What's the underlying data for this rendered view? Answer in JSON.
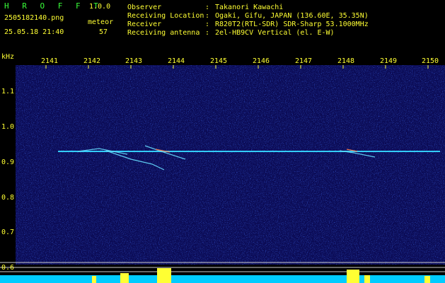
{
  "app": {
    "name": "H R O F F T",
    "version": "1.0.0",
    "filename": "2505182140.png",
    "datetime": "25.05.18 21:40",
    "mode_label": "meteor",
    "count": "57"
  },
  "info": {
    "rows": [
      {
        "label": "Observer",
        "sep": ":",
        "value": "Takanori Kawachi"
      },
      {
        "label": "Receiving Location",
        "sep": ":",
        "value": "Ogaki, Gifu, JAPAN (136.60E, 35.35N)"
      },
      {
        "label": "Receiver",
        "sep": ":",
        "value": "R820T2(RTL-SDR) SDR-Sharp 53.1000MHz"
      },
      {
        "label": "Receiving antenna",
        "sep": ":",
        "value": "2el-HB9CV Vertical (el. E-W)"
      }
    ]
  },
  "axis": {
    "unit": "kHz",
    "x_ticks": [
      "2141",
      "2142",
      "2143",
      "2144",
      "2145",
      "2146",
      "2147",
      "2148",
      "2149",
      "2150"
    ],
    "y_ticks": [
      "1.1",
      "1.0",
      "0.9",
      "0.8",
      "0.7",
      "0.6"
    ]
  },
  "colors": {
    "background": "#000000",
    "waterfall": "#0a0a6e",
    "text_green": "#39ff39",
    "text_yellow": "#ffff33",
    "carrier": "#33ccff"
  }
}
